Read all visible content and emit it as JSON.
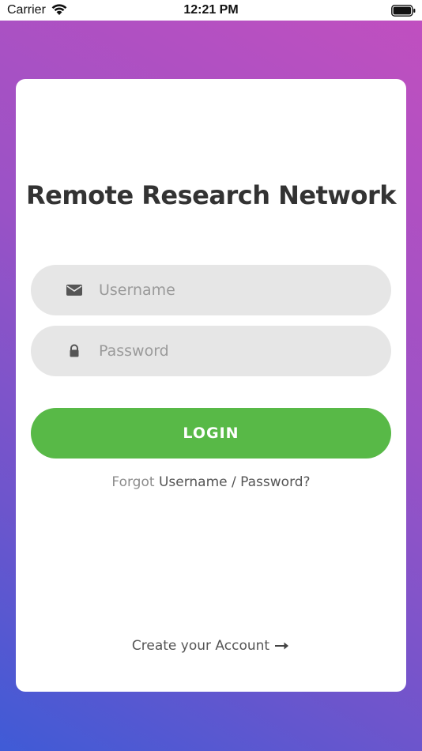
{
  "status_bar": {
    "carrier": "Carrier",
    "time": "12:21 PM",
    "icons": [
      "wifi-icon",
      "battery-icon"
    ]
  },
  "card": {
    "title": "Remote Research Network"
  },
  "form": {
    "username_placeholder": "Username",
    "username_value": "",
    "username_icon": "envelope-icon",
    "password_placeholder": "Password",
    "password_value": "",
    "password_icon": "lock-icon",
    "login_label": "LOGIN"
  },
  "links": {
    "forgot_prefix": "Forgot",
    "forgot_link": "Username / Password?",
    "create_account": "Create your Account",
    "create_account_icon": "arrow-right-icon"
  },
  "colors": {
    "gradient_top": "#c24fbf",
    "gradient_bottom": "#3f5bd6",
    "login_button": "#58b947",
    "field_bg": "#e6e6e6",
    "title_text": "#333333"
  }
}
